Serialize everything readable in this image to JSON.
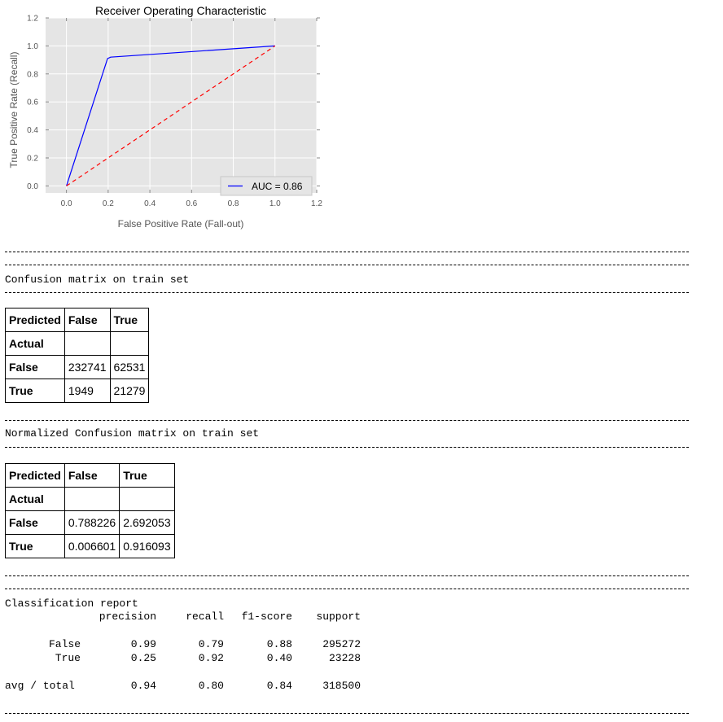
{
  "chart_data": {
    "type": "line",
    "title": "Receiver Operating Characteristic",
    "xlabel": "False Positive Rate (Fall-out)",
    "ylabel": "True Positive Rate (Recall)",
    "xlim": [
      -0.1,
      1.2
    ],
    "ylim": [
      -0.05,
      1.2
    ],
    "xticks": [
      "0.0",
      "0.2",
      "0.4",
      "0.6",
      "0.8",
      "1.0",
      "1.2"
    ],
    "yticks": [
      "0.0",
      "0.2",
      "0.4",
      "0.6",
      "0.8",
      "1.0",
      "1.2"
    ],
    "grid": true,
    "legend_position": "lower right",
    "series": [
      {
        "name": "AUC = 0.86",
        "color": "#0000ff",
        "style": "solid",
        "x": [
          0.0,
          0.197,
          0.212,
          1.0
        ],
        "y": [
          0.0,
          0.91,
          0.92,
          1.0
        ]
      },
      {
        "color": "#ff0000",
        "style": "dashed",
        "x": [
          0.0,
          1.0
        ],
        "y": [
          0.0,
          1.0
        ]
      }
    ]
  },
  "sections": {
    "train_cm_title": "Confusion matrix on train set",
    "norm_cm_title": "Normalized Confusion matrix on train set",
    "report_title": "Classification report"
  },
  "confusion_matrix": {
    "header": [
      "Predicted",
      "False",
      "True"
    ],
    "index_label": "Actual",
    "rows": [
      {
        "label": "False",
        "values": [
          "232741",
          "62531"
        ]
      },
      {
        "label": "True",
        "values": [
          "1949",
          "21279"
        ]
      }
    ]
  },
  "normalized_confusion_matrix": {
    "header": [
      "Predicted",
      "False",
      "True"
    ],
    "index_label": "Actual",
    "rows": [
      {
        "label": "False",
        "values": [
          "0.788226",
          "2.692053"
        ]
      },
      {
        "label": "True",
        "values": [
          "0.006601",
          "0.916093"
        ]
      }
    ]
  },
  "classification_report": {
    "columns": [
      "precision",
      "recall",
      "f1-score",
      "support"
    ],
    "rows": [
      {
        "label": "False",
        "precision": "0.99",
        "recall": "0.79",
        "f1": "0.88",
        "support": "295272"
      },
      {
        "label": "True",
        "precision": "0.25",
        "recall": "0.92",
        "f1": "0.40",
        "support": "23228"
      }
    ],
    "avg": {
      "label": "avg / total",
      "precision": "0.94",
      "recall": "0.80",
      "f1": "0.84",
      "support": "318500"
    }
  }
}
